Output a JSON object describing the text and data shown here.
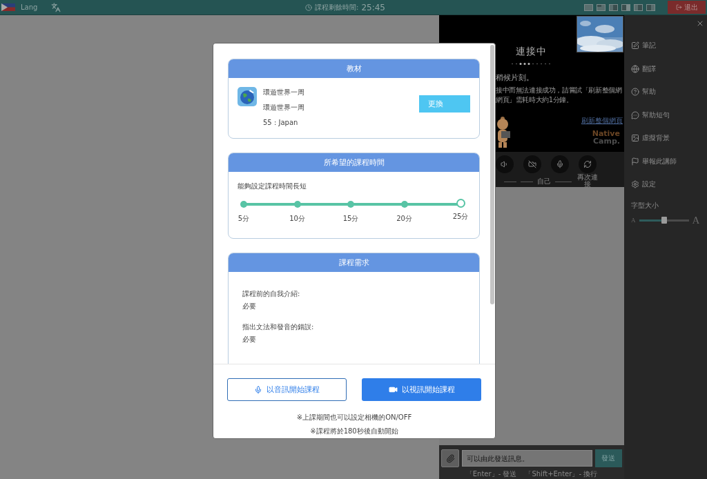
{
  "top_bar": {
    "language": "Lang",
    "timer_label": "課程剩餘時間:",
    "timer": "25:45",
    "exit_button": "退出"
  },
  "video": {
    "status": "連接中",
    "message": "稍候片刻。",
    "description": [
      "接中而無法連接成功，請嘗試「刷新整個網",
      "網頁」需耗時大約1分鐘。"
    ],
    "refresh_link": "刷新整個網頁",
    "logo": [
      "Native",
      "Camp."
    ],
    "controls": [
      {
        "kind": "speaker"
      },
      {
        "kind": "camera_off"
      },
      {
        "kind": "mic"
      },
      {
        "kind": "reconnect",
        "label": "再次連接"
      }
    ],
    "self_label": "自己"
  },
  "sidebar": {
    "items": [
      {
        "kind": "note",
        "label": "筆記"
      },
      {
        "kind": "translate",
        "label": "翻譯"
      },
      {
        "kind": "help",
        "label": "幫助"
      },
      {
        "kind": "phrases",
        "label": "幫助短句"
      },
      {
        "kind": "background",
        "label": "虛擬背景"
      },
      {
        "kind": "report",
        "label": "舉報此講師"
      },
      {
        "kind": "settings",
        "label": "設定"
      }
    ],
    "font_size": {
      "label": "字型大小",
      "small": "A",
      "large": "A",
      "level": 0.5
    }
  },
  "chat": {
    "placeholder": "可以由此發送訊息。",
    "send_button": "發送",
    "hints": [
      "「Enter」- 發送",
      "「Shift+Enter」- 換行"
    ]
  },
  "modal": {
    "material": {
      "title": "教材",
      "lines": [
        "環遊世界一周",
        "環遊世界一周",
        "55 : Japan"
      ],
      "change_button": "更換"
    },
    "duration": {
      "title": "所希望的課程時間",
      "caption": "能夠設定課程時間長短",
      "stops": [
        {
          "label": "5分",
          "selected": false
        },
        {
          "label": "10分",
          "selected": false
        },
        {
          "label": "15分",
          "selected": false
        },
        {
          "label": "20分",
          "selected": false
        },
        {
          "label": "25分",
          "selected": true
        }
      ]
    },
    "requests": {
      "title": "課程需求",
      "items": [
        {
          "label": "課程前的自我介紹:",
          "value": "必要"
        },
        {
          "label": "指出文法和發音的錯誤:",
          "value": "必要"
        }
      ]
    },
    "buttons": [
      {
        "kind": "audio",
        "label": "以音訊開始課程"
      },
      {
        "kind": "video",
        "label": "以視訊開始課程"
      }
    ],
    "notes": [
      "※上課期間也可以設定相機的ON/OFF",
      "※課程將於180秒後自動開始"
    ]
  }
}
